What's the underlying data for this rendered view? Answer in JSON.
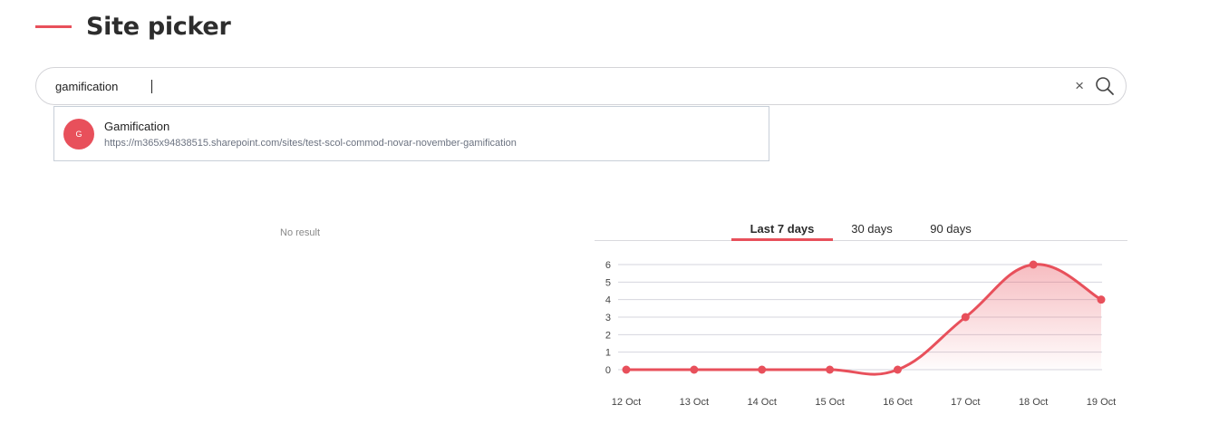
{
  "header": {
    "title": "Site picker"
  },
  "search": {
    "value": "gamification",
    "clear_glyph": "×"
  },
  "results": [
    {
      "initial": "G",
      "title": "Gamification",
      "url": "https://m365x94838515.sharepoint.com/sites/test-scol-commod-novar-november-gamification"
    }
  ],
  "empty_state": {
    "text": "No result"
  },
  "tabs": [
    {
      "label": "Last 7 days",
      "active": true
    },
    {
      "label": "30 days",
      "active": false
    },
    {
      "label": "90 days",
      "active": false
    }
  ],
  "colors": {
    "accent": "#e8505b"
  },
  "icons": {
    "clear": "close-icon",
    "search": "search-icon"
  },
  "chart_data": {
    "type": "area",
    "categories": [
      "12 Oct",
      "13 Oct",
      "14 Oct",
      "15 Oct",
      "16 Oct",
      "17 Oct",
      "18 Oct",
      "19 Oct"
    ],
    "series": [
      {
        "values": [
          0,
          0,
          0,
          0,
          0,
          3,
          6,
          4
        ]
      }
    ],
    "yticks": [
      0,
      1,
      2,
      3,
      4,
      5,
      6
    ],
    "ylim": [
      0,
      6
    ],
    "grid": true,
    "legend": "none",
    "color": "#e8505b"
  }
}
